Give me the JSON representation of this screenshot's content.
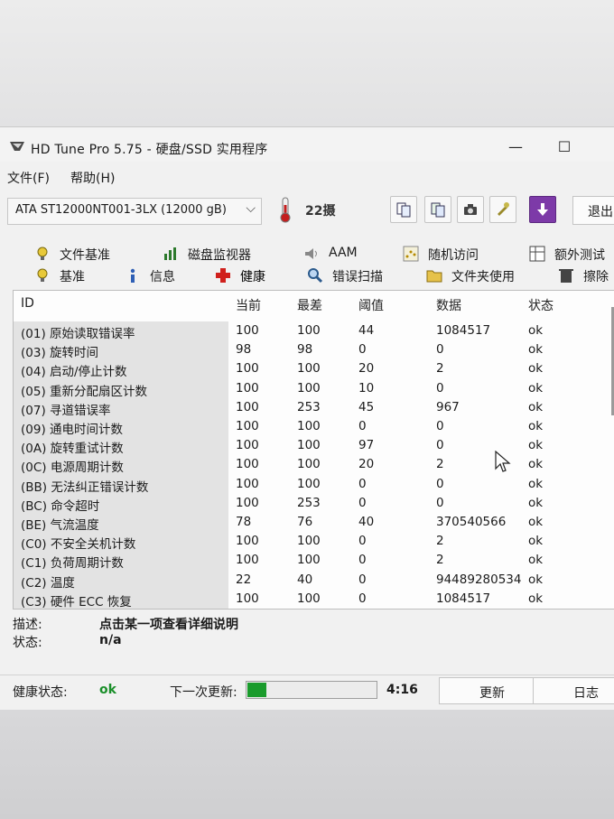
{
  "window": {
    "title": "HD Tune Pro 5.75 - 硬盘/SSD 实用程序",
    "controls": {
      "minimize": "—",
      "maximize": "☐"
    }
  },
  "menu": [
    "文件(F)",
    "帮助(H)"
  ],
  "toolbar": {
    "drive": "ATA    ST12000NT001-3LX (12000 gB)",
    "temperature": "22",
    "temperature_unit": "摄",
    "exit_label": "退出"
  },
  "tabs": {
    "row1": [
      "文件基准",
      "磁盘监视器",
      "AAM",
      "随机访问",
      "额外测试"
    ],
    "row2": [
      "基准",
      "信息",
      "健康",
      "错误扫描",
      "文件夹使用",
      "擦除"
    ],
    "active": "健康"
  },
  "smart": {
    "headers": [
      "ID",
      "当前",
      "最差",
      "阈值",
      "数据",
      "状态"
    ],
    "rows": [
      [
        "(01) 原始读取错误率",
        "100",
        "100",
        "44",
        "1084517",
        "ok"
      ],
      [
        "(03) 旋转时间",
        "98",
        "98",
        "0",
        "0",
        "ok"
      ],
      [
        "(04) 启动/停止计数",
        "100",
        "100",
        "20",
        "2",
        "ok"
      ],
      [
        "(05) 重新分配扇区计数",
        "100",
        "100",
        "10",
        "0",
        "ok"
      ],
      [
        "(07) 寻道错误率",
        "100",
        "253",
        "45",
        "967",
        "ok"
      ],
      [
        "(09) 通电时间计数",
        "100",
        "100",
        "0",
        "0",
        "ok"
      ],
      [
        "(0A) 旋转重试计数",
        "100",
        "100",
        "97",
        "0",
        "ok"
      ],
      [
        "(0C) 电源周期计数",
        "100",
        "100",
        "20",
        "2",
        "ok"
      ],
      [
        "(BB) 无法纠正错误计数",
        "100",
        "100",
        "0",
        "0",
        "ok"
      ],
      [
        "(BC) 命令超时",
        "100",
        "253",
        "0",
        "0",
        "ok"
      ],
      [
        "(BE) 气流温度",
        "78",
        "76",
        "40",
        "370540566",
        "ok"
      ],
      [
        "(C0) 不安全关机计数",
        "100",
        "100",
        "0",
        "2",
        "ok"
      ],
      [
        "(C1) 负荷周期计数",
        "100",
        "100",
        "0",
        "2",
        "ok"
      ],
      [
        "(C2) 温度",
        "22",
        "40",
        "0",
        "94489280534",
        "ok"
      ],
      [
        "(C3) 硬件 ECC 恢复",
        "100",
        "100",
        "0",
        "1084517",
        "ok"
      ]
    ]
  },
  "details": {
    "description_label": "描述:",
    "description_value": "点击某一项查看详细说明",
    "status_label": "状态:",
    "status_value": "n/a"
  },
  "statusbar": {
    "health_label": "健康状态:",
    "health_value": "ok",
    "next_update_label": "下一次更新:",
    "progress_fraction": 0.15,
    "countdown": "4:16",
    "update_button": "更新",
    "log_button": "日志"
  },
  "colors": {
    "ok_green": "#1a8f2a",
    "progress_green": "#1a9b2c"
  }
}
